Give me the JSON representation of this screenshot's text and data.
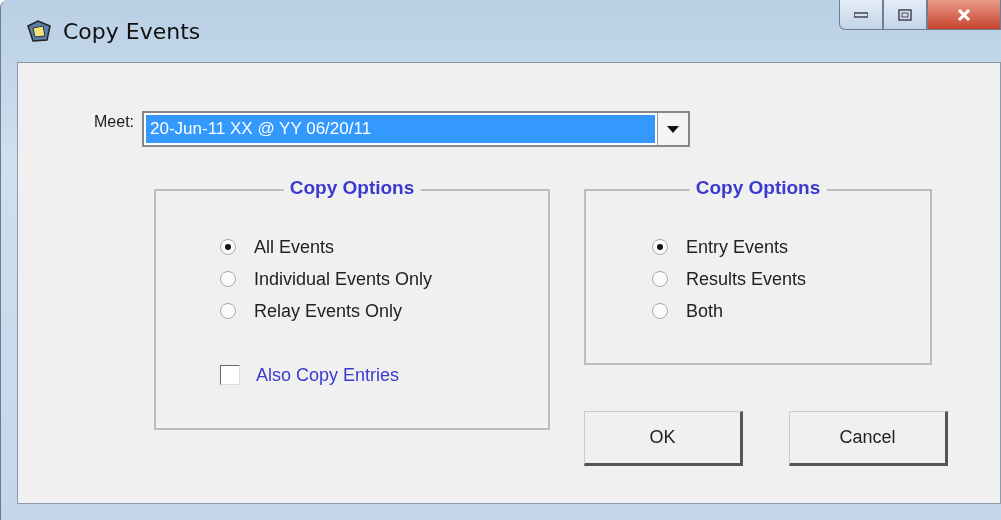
{
  "window": {
    "title": "Copy Events"
  },
  "meet": {
    "label": "Meet:",
    "value": "20-Jun-11 XX @ YY 06/20/11",
    "selected": true
  },
  "groups": [
    {
      "title": "Copy Options",
      "options": [
        {
          "label": "All Events",
          "selected": true
        },
        {
          "label": "Individual Events Only",
          "selected": false
        },
        {
          "label": "Relay Events Only",
          "selected": false
        }
      ],
      "checkbox": {
        "label": "Also Copy Entries",
        "checked": false
      }
    },
    {
      "title": "Copy Options",
      "options": [
        {
          "label": "Entry Events",
          "selected": true
        },
        {
          "label": "Results Events",
          "selected": false
        },
        {
          "label": "Both",
          "selected": false
        }
      ]
    }
  ],
  "buttons": [
    "OK",
    "Cancel"
  ]
}
